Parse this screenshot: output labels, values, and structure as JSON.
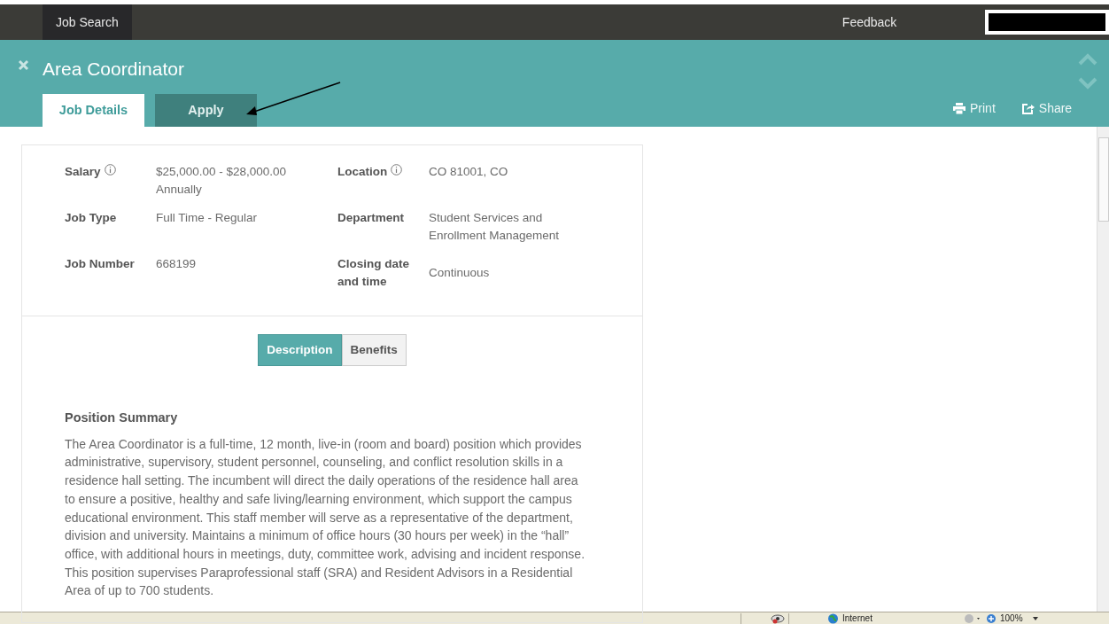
{
  "top_nav": {
    "items": [
      {
        "label": "Job Search",
        "selected": true
      },
      {
        "label": "Feedback",
        "selected": false
      }
    ]
  },
  "header": {
    "title": "Area Coordinator",
    "tabs": [
      {
        "label": "Job Details",
        "selected": true
      },
      {
        "label": "Apply",
        "selected": false
      }
    ],
    "actions": [
      "Print",
      "Share"
    ]
  },
  "details": [
    {
      "label": "Salary",
      "info": true,
      "value": "$25,000.00 - $28,000.00\nAnnually"
    },
    {
      "label": "Location",
      "info": true,
      "value": "CO 81001, CO"
    },
    {
      "label": "Job Type",
      "info": false,
      "value": "Full Time - Regular"
    },
    {
      "label": "Department",
      "info": false,
      "value": "Student Services and\nEnrollment Management"
    },
    {
      "label": "Job Number",
      "info": false,
      "value": "668199"
    },
    {
      "label": "Closing date\nand time",
      "info": false,
      "value": "Continuous"
    }
  ],
  "section_tabs": [
    {
      "label": "Description",
      "selected": true
    },
    {
      "label": "Benefits",
      "selected": false
    }
  ],
  "description": {
    "heading": "Position Summary",
    "text": "The Area Coordinator is a full-time, 12 month, live-in (room and board) position which provides administrative, supervisory, student personnel, counseling, and conflict resolution skills in a residence hall setting. The incumbent will direct the daily operations of the residence hall area to ensure a positive, healthy and safe living/learning environment, which support the campus educational environment. This staff member will serve as a representative of the department, division and university. Maintains a minimum of office hours (30 hours per week) in the “hall” office, with additional hours in meetings, duty, committee work, advising and incident response. This position supervises Paraprofessional staff (SRA) and Resident Advisors in a Residential Area of up to 700 students."
  },
  "status_bar": {
    "zone": "Internet",
    "zoom": "100%"
  }
}
